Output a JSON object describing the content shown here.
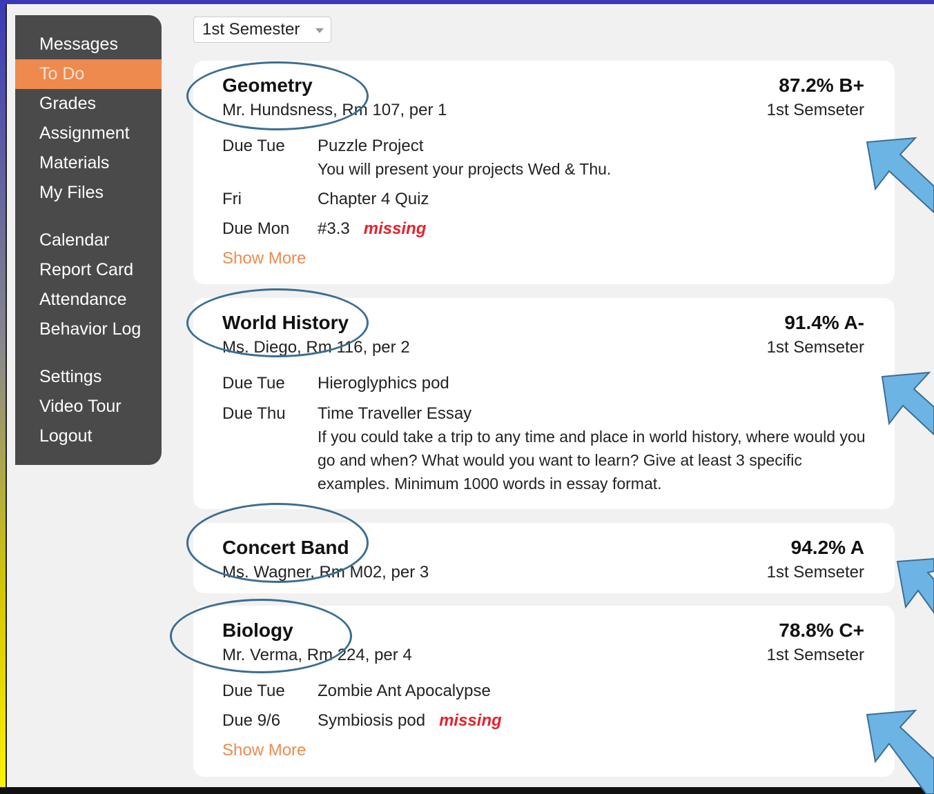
{
  "semester_select": {
    "value": "1st Semester"
  },
  "sidebar": {
    "items": [
      {
        "label": "Messages"
      },
      {
        "label": "To Do"
      },
      {
        "label": "Grades"
      },
      {
        "label": "Assignment"
      },
      {
        "label": "Materials"
      },
      {
        "label": "My Files"
      },
      {
        "label": "Calendar"
      },
      {
        "label": "Report Card"
      },
      {
        "label": "Attendance"
      },
      {
        "label": "Behavior Log"
      },
      {
        "label": "Settings"
      },
      {
        "label": "Video Tour"
      },
      {
        "label": "Logout"
      }
    ],
    "active_item": "To Do"
  },
  "courses": [
    {
      "title": "Geometry",
      "info": "Mr. Hundsness, Rm 107, per 1",
      "grade": "87.2%  B+",
      "term": "1st Semseter",
      "assignments": [
        {
          "when": "Due Tue",
          "title": "Puzzle Project",
          "desc": "You will present your projects Wed & Thu."
        },
        {
          "when": "Fri",
          "title": "Chapter 4 Quiz"
        },
        {
          "when": "Due Mon",
          "title": "#3.3",
          "status": "missing"
        }
      ],
      "show_more": "Show More"
    },
    {
      "title": "World History",
      "info": "Ms. Diego, Rm 116, per 2",
      "grade": "91.4%  A-",
      "term": "1st Semseter",
      "assignments": [
        {
          "when": "Due Tue",
          "title": "Hieroglyphics pod"
        },
        {
          "when": "Due Thu",
          "title": "Time Traveller Essay",
          "desc": "If you could take a trip to any time and place in world history, where would you go and when? What would you want to learn? Give at least 3 specific examples. Minimum 1000 words in essay format."
        }
      ]
    },
    {
      "title": "Concert Band",
      "info": "Ms. Wagner, Rm M02, per 3",
      "grade": "94.2%  A",
      "term": "1st Semseter"
    },
    {
      "title": "Biology",
      "info": "Mr. Verma, Rm 224, per 4",
      "grade": "78.8%  C+",
      "term": "1st Semseter",
      "assignments": [
        {
          "when": "Due Tue",
          "title": "Zombie Ant Apocalypse"
        },
        {
          "when": "Due 9/6",
          "title": "Symbiosis pod",
          "status": "missing"
        }
      ],
      "show_more": "Show More"
    }
  ],
  "colors": {
    "accent": "#ee8a4e",
    "missing": "#e3232d",
    "sidebar_bg": "#4a4a4a",
    "annotation_arrow": "#6cb4e4",
    "annotation_oval": "#3a6e93",
    "background": "#3a3ab8"
  },
  "icons": {
    "select_caret": "caret-down-icon",
    "annotation": "arrow-icon"
  }
}
